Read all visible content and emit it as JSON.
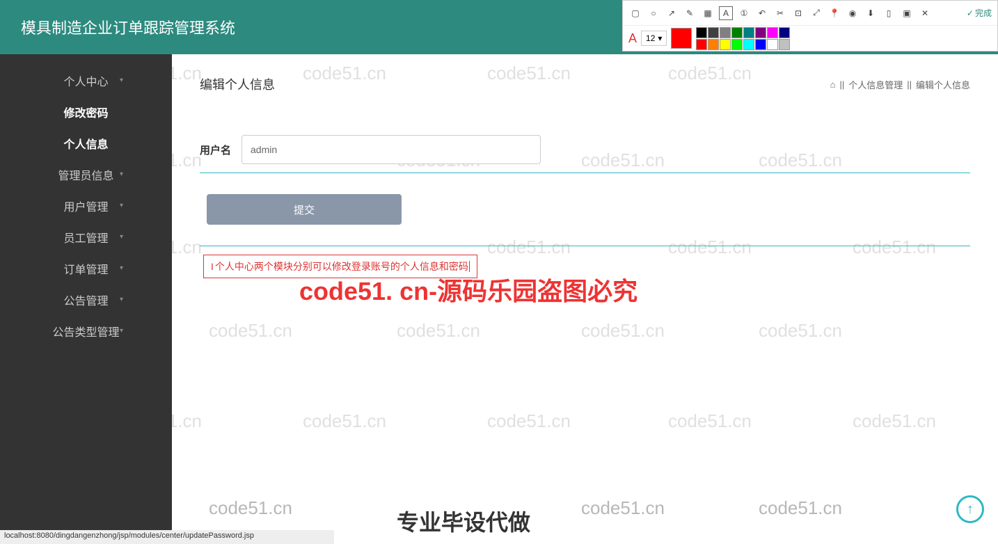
{
  "header": {
    "title": "模具制造企业订单跟踪管理系统"
  },
  "toolbar": {
    "font_letter": "A",
    "font_size": "12",
    "done_label": "完成"
  },
  "sidebar": {
    "items": [
      {
        "label": "个人中心",
        "bold": false,
        "arrow": true
      },
      {
        "label": "修改密码",
        "bold": true,
        "arrow": false
      },
      {
        "label": "个人信息",
        "bold": true,
        "arrow": false
      },
      {
        "label": "管理员信息",
        "bold": false,
        "arrow": true
      },
      {
        "label": "用户管理",
        "bold": false,
        "arrow": true
      },
      {
        "label": "员工管理",
        "bold": false,
        "arrow": true
      },
      {
        "label": "订单管理",
        "bold": false,
        "arrow": true
      },
      {
        "label": "公告管理",
        "bold": false,
        "arrow": true
      },
      {
        "label": "公告类型管理",
        "bold": false,
        "arrow": true
      }
    ]
  },
  "breadcrumb": {
    "level1": "个人信息管理",
    "level2": "编辑个人信息"
  },
  "page": {
    "title": "编辑个人信息"
  },
  "form": {
    "username_label": "用户名",
    "username_value": "admin",
    "submit_label": "提交"
  },
  "note": {
    "text": "个人中心两个模块分别可以修改登录账号的个人信息和密码"
  },
  "watermarks": {
    "repeat": "code51.cn",
    "big": "code51. cn-源码乐园盗图必究",
    "footer": "专业毕设代做",
    "partial": "1.cn"
  },
  "statusbar": {
    "text": "localhost:8080/dingdangenzhong/jsp/modules/center/updatePassword.jsp"
  },
  "colors": {
    "grid": [
      "#000",
      "#404040",
      "#808080",
      "#008000",
      "#008080",
      "#800080",
      "#ff00ff",
      "#000080",
      "#ff0000",
      "#ff8000",
      "#ffff00",
      "#00ff00",
      "#00ffff",
      "#0000ff",
      "#ffffff",
      "#c0c0c0"
    ]
  }
}
